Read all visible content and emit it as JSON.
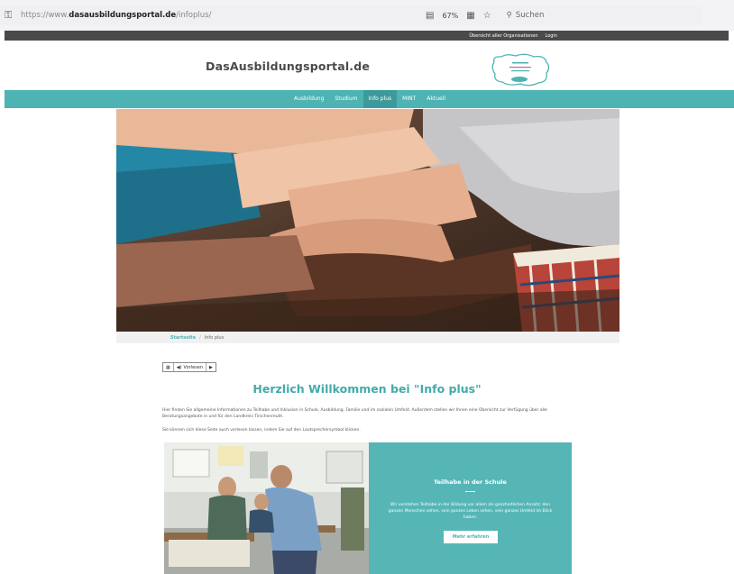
{
  "browser": {
    "url_prefix": "https://www.",
    "url_domain": "dasausbildungsportal.de",
    "url_path": "/infoplus/",
    "zoom": "67%",
    "search_placeholder": "Suchen"
  },
  "topbar": {
    "links": [
      "Übersicht aller Organisationen",
      "Login"
    ]
  },
  "header": {
    "brand": "DasAusbildungsportal.de"
  },
  "nav": {
    "items": [
      "Ausbildung",
      "Studium",
      "Info plus",
      "MINT",
      "Aktuell"
    ],
    "active_index": 2
  },
  "breadcrumb": {
    "home": "Startseite",
    "separator": "/",
    "current": "Info plus"
  },
  "readspeaker": {
    "label": "Vorlesen"
  },
  "main": {
    "title": "Herzlich Willkommen bei \"Info plus\"",
    "intro": "Hier finden Sie allgemeine Informationen zu Teilhabe und Inklusion in Schule, Ausbildung, Familie und im sozialen Umfeld. Außerdem stellen wir Ihnen eine Übersicht zur Verfügung über alle Beratungsangebote in und für den Landkreis Tirschenreuth.",
    "intro2": "Sie können sich diese Seite auch vorlesen lassen, indem Sie auf den Lautsprechersymbol klicken."
  },
  "feature": {
    "title": "Teilhabe in der Schule",
    "text": "Wir verstehen Teilhabe in der Bildung vor allem als ganzheitlichen Ansatz: den ganzen Menschen sehen, sein ganzes Leben sehen, sein ganzes Umfeld im Blick haben.",
    "button": "Mehr erfahren"
  },
  "colors": {
    "accent": "#4db3b3",
    "accent_dark": "#3e9a9a",
    "topbar": "#4a4a4a"
  }
}
